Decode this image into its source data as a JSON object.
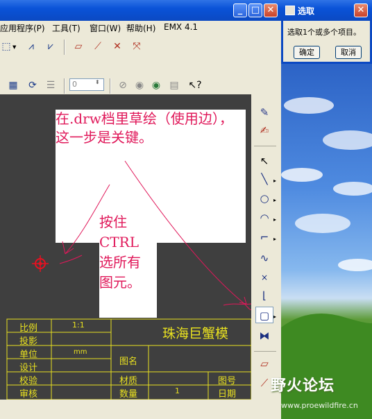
{
  "app": {
    "menu": [
      {
        "label": "应用程序(P)"
      },
      {
        "label": "工具(T)"
      },
      {
        "label": "窗口(W)"
      },
      {
        "label": "帮助(H)"
      },
      {
        "label": "EMX 4.1"
      }
    ],
    "toolbar2": {
      "number_field_value": "0"
    },
    "window_buttons": {
      "minimize": "_",
      "maximize": "□",
      "close": "✕"
    }
  },
  "annotation": {
    "main_text": "在.drw档里草绘（使用边），这一步是关键。",
    "side_text": "按住CTRL选所有图元。"
  },
  "title_block": {
    "rows": [
      {
        "label": "比例",
        "value": "1:1"
      },
      {
        "label": "投影",
        "value": ""
      },
      {
        "label": "单位",
        "value": "mm"
      },
      {
        "label": "设计",
        "value": ""
      },
      {
        "label": "校验",
        "value": ""
      },
      {
        "label": "审核",
        "value": ""
      }
    ],
    "company": "珠海巨蟹模",
    "drawing_name_label": "图名",
    "material_label": "材质",
    "quantity_label": "数量",
    "quantity_value": "1",
    "drawing_no_label": "图号",
    "date_label": "日期"
  },
  "dialog": {
    "title": "选取",
    "message": "选取1个或多个项目。",
    "ok_label": "确定",
    "cancel_label": "取消",
    "close_glyph": "✕"
  },
  "watermark": {
    "text": "野火论坛",
    "url": "www.proewildfire.cn"
  },
  "colors": {
    "canvas": "#3F3F3F",
    "annotation_text": "#E0185A",
    "title_block_text": "#E8E020",
    "xp_blue": "#0B49C2"
  }
}
